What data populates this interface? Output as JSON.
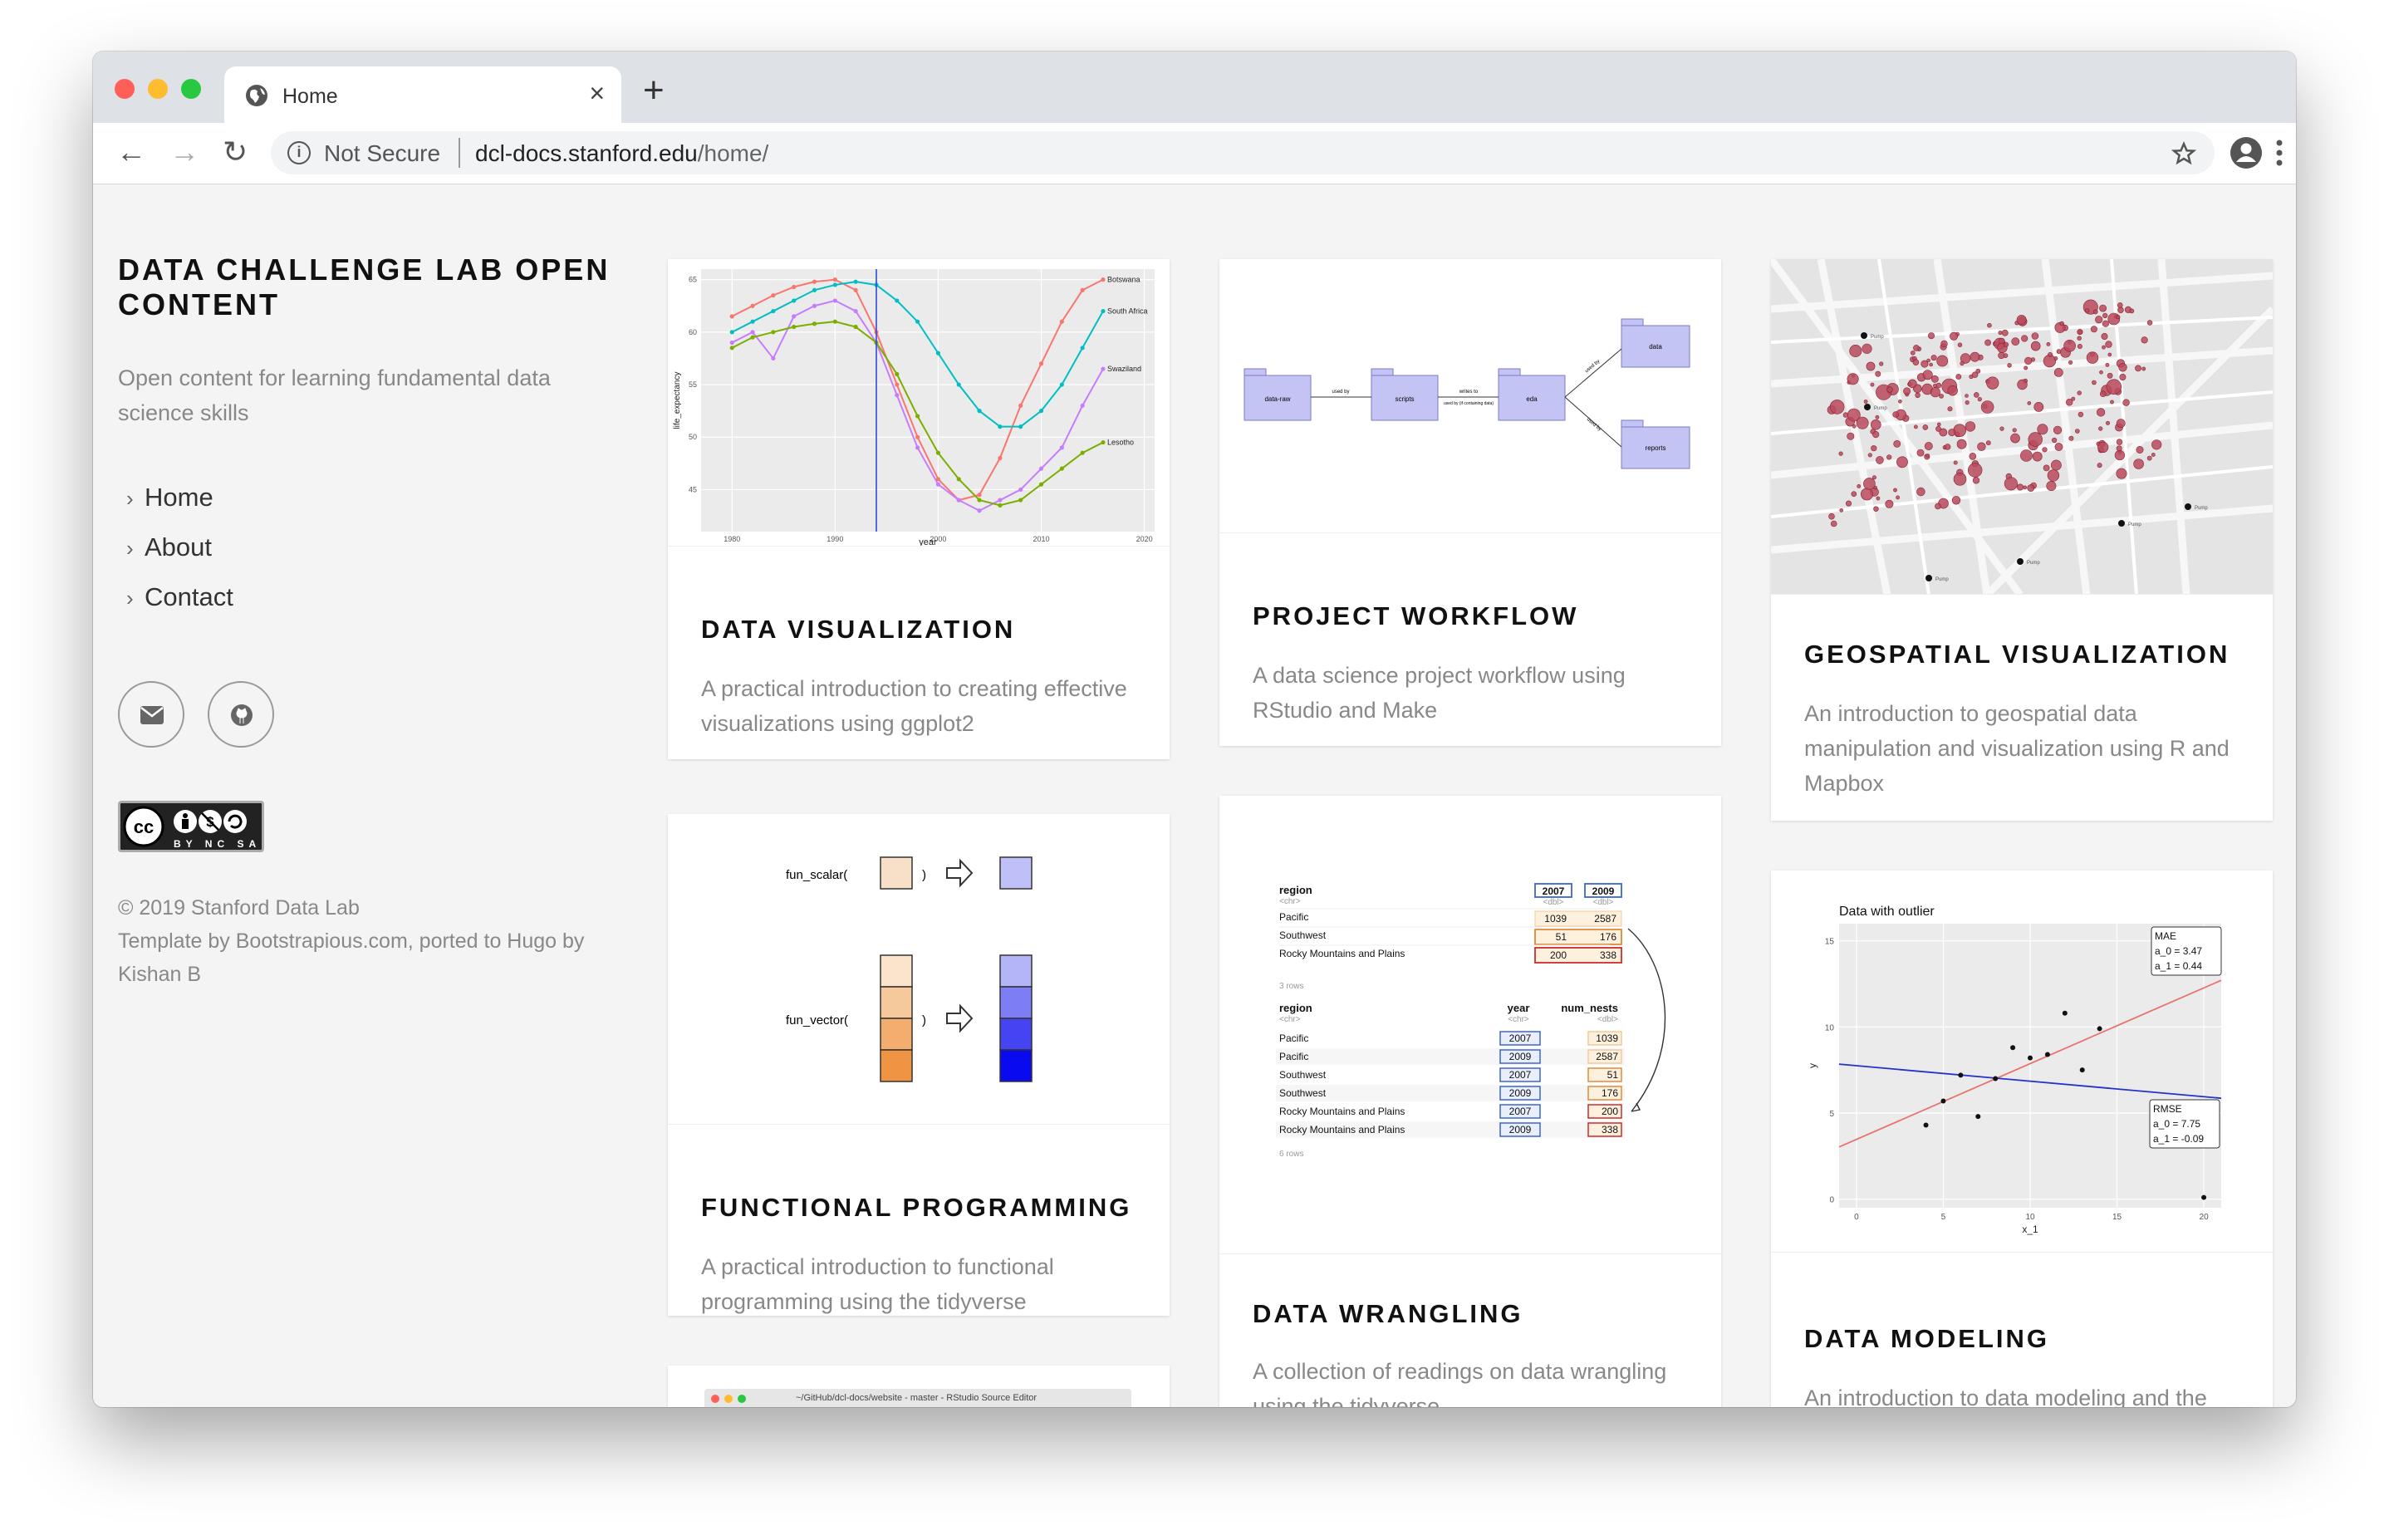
{
  "browser": {
    "tab_title": "Home",
    "url_security": "Not Secure",
    "url_host": "dcl-docs.stanford.edu",
    "url_path": "/home/"
  },
  "sidebar": {
    "title": "DATA CHALLENGE LAB OPEN CONTENT",
    "tagline": "Open content for learning fundamental data science skills",
    "nav": [
      {
        "label": "Home"
      },
      {
        "label": "About"
      },
      {
        "label": "Contact"
      }
    ],
    "license_label": "BY NC SA",
    "footer_line1": "© 2019 Stanford Data Lab",
    "footer_line2": "Template by Bootstrapious.com, ported to Hugo by Kishan B"
  },
  "cards": {
    "data_visualization": {
      "title": "DATA VISUALIZATION",
      "desc": "A practical introduction to creating effective visualizations using ggplot2"
    },
    "project_workflow": {
      "title": "PROJECT WORKFLOW",
      "desc": "A data science project workflow using RStudio and Make"
    },
    "geospatial": {
      "title": "GEOSPATIAL VISUALIZATION",
      "desc": "An introduction to geospatial data manipulation and visualization using R and Mapbox"
    },
    "functional_programming": {
      "title": "FUNCTIONAL PROGRAMMING",
      "desc": "A practical introduction to functional programming using the tidyverse"
    },
    "data_wrangling": {
      "title": "DATA WRANGLING",
      "desc": "A collection of readings on data wrangling using the tidyverse"
    },
    "data_modeling": {
      "title": "DATA MODELING",
      "desc": "An introduction to data modeling and the"
    }
  },
  "thumbs": {
    "workflow": {
      "nodes": [
        "data-raw",
        "scripts",
        "eda",
        "data",
        "reports"
      ],
      "edges": [
        "used by",
        "writes to",
        "used by (if containing data)",
        "used by",
        "used by"
      ]
    },
    "fp": {
      "scalar": "fun_scalar(",
      "vector": "fun_vector(",
      "close": ")"
    },
    "wrangle": {
      "top_header": [
        "region",
        "2007",
        "2009"
      ],
      "top_types": [
        "<chr>",
        "<dbl>",
        "<dbl>"
      ],
      "top_rows": [
        [
          "Pacific",
          "1039",
          "2587"
        ],
        [
          "Southwest",
          "51",
          "176"
        ],
        [
          "Rocky Mountains and Plains",
          "200",
          "338"
        ]
      ],
      "top_count": "3 rows",
      "bottom_header": [
        "region",
        "year",
        "num_nests"
      ],
      "bottom_types": [
        "<chr>",
        "<chr>",
        "<dbl>"
      ],
      "bottom_rows": [
        [
          "Pacific",
          "2007",
          "1039"
        ],
        [
          "Pacific",
          "2009",
          "2587"
        ],
        [
          "Southwest",
          "2007",
          "51"
        ],
        [
          "Southwest",
          "2009",
          "176"
        ],
        [
          "Rocky Mountains and Plains",
          "2007",
          "200"
        ],
        [
          "Rocky Mountains and Plains",
          "2009",
          "338"
        ]
      ],
      "bottom_count": "6 rows"
    },
    "model": {
      "mae": [
        "MAE",
        "a_0 = 3.47",
        "a_1 = 0.44"
      ],
      "rmse": [
        "RMSE",
        "a_0 = 7.75",
        "a_1 = -0.09"
      ]
    },
    "rstudio_title": "~/GitHub/dcl-docs/website - master - RStudio Source Editor",
    "map_label": "Pump"
  },
  "chart_data": [
    {
      "type": "line",
      "xlabel": "year",
      "ylabel": "life_expectancy",
      "xlim": [
        1977,
        2021
      ],
      "ylim": [
        41,
        66
      ],
      "xticks": [
        1980,
        1990,
        2000,
        2010,
        2020
      ],
      "yticks": [
        45,
        50,
        55,
        60,
        65
      ],
      "vline": 1994,
      "x": [
        1980,
        1982,
        1984,
        1986,
        1988,
        1990,
        1992,
        1994,
        1996,
        1998,
        2000,
        2002,
        2004,
        2006,
        2008,
        2010,
        2012,
        2014,
        2016
      ],
      "series": [
        {
          "name": "Botswana",
          "color": "#f8766d",
          "values": [
            61.5,
            62.5,
            63.5,
            64.3,
            64.8,
            65,
            64,
            60,
            55,
            50,
            46,
            44,
            44.5,
            48,
            53,
            57,
            61,
            64,
            65
          ]
        },
        {
          "name": "South Africa",
          "color": "#00bfc4",
          "values": [
            60,
            61,
            62,
            63,
            64,
            64.5,
            64.8,
            64.5,
            63,
            61,
            58,
            55,
            52.5,
            51,
            51,
            52.5,
            55,
            58.5,
            62
          ]
        },
        {
          "name": "Swaziland",
          "color": "#c77cff",
          "values": [
            59,
            60,
            57.5,
            61.5,
            62.5,
            63,
            62,
            59,
            54,
            49,
            45.5,
            44,
            43,
            44,
            45,
            47,
            49,
            53,
            56.5
          ]
        },
        {
          "name": "Lesotho",
          "color": "#7cae00",
          "values": [
            58.5,
            59.5,
            60,
            60.5,
            60.8,
            61,
            60.5,
            59,
            56,
            52,
            48.5,
            46,
            44,
            43.5,
            44,
            45.5,
            47,
            48.5,
            49.5
          ]
        }
      ]
    },
    {
      "type": "scatter",
      "title": "Data with outlier",
      "xlabel": "x_1",
      "ylabel": "y",
      "xlim": [
        -1,
        21
      ],
      "ylim": [
        -0.5,
        16
      ],
      "xticks": [
        0,
        5,
        10,
        15,
        20
      ],
      "yticks": [
        0,
        5,
        10,
        15
      ],
      "x": [
        4,
        5,
        6,
        7,
        8,
        9,
        10,
        11,
        12,
        13,
        14,
        20
      ],
      "y": [
        4.3,
        5.7,
        7.2,
        4.8,
        7,
        8.8,
        8.2,
        8.4,
        10.8,
        7.5,
        9.9,
        0.1
      ],
      "fits": [
        {
          "name": "MAE",
          "color": "#e8736c",
          "a0": 3.47,
          "a1": 0.44
        },
        {
          "name": "RMSE",
          "color": "#2233cc",
          "a0": 7.75,
          "a1": -0.09
        }
      ]
    }
  ]
}
